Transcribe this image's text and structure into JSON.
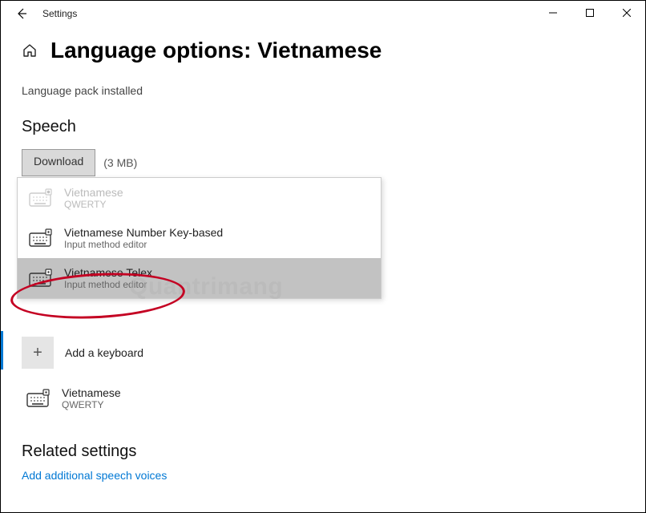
{
  "window": {
    "title": "Settings"
  },
  "page": {
    "title": "Language options: Vietnamese",
    "status": "Language pack installed"
  },
  "speech": {
    "heading": "Speech",
    "download_label": "Download",
    "download_size": "(3 MB)"
  },
  "dropdown": {
    "items": [
      {
        "name": "Vietnamese",
        "sub": "QWERTY"
      },
      {
        "name": "Vietnamese Number Key-based",
        "sub": "Input method editor"
      },
      {
        "name": "Vietnamese Telex",
        "sub": "Input method editor"
      }
    ]
  },
  "add_keyboard": {
    "label": "Add a keyboard"
  },
  "installed": {
    "name": "Vietnamese",
    "sub": "QWERTY"
  },
  "related": {
    "heading": "Related settings",
    "link": "Add additional speech voices"
  },
  "watermark": "Quantrimang"
}
